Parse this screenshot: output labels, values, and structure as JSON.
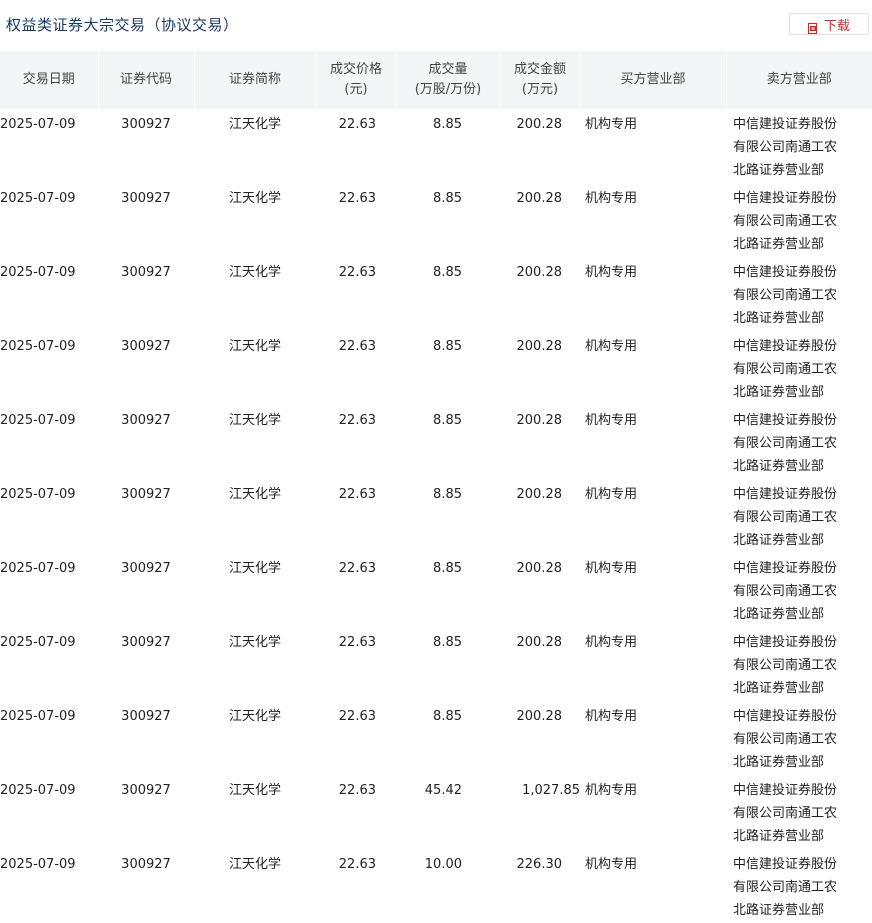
{
  "header": {
    "title": "权益类证券大宗交易（协议交易）",
    "download_label": "下载",
    "download_icon": "pdf-download-icon"
  },
  "table": {
    "columns": [
      {
        "line1": "交易日期",
        "line2": ""
      },
      {
        "line1": "证券代码",
        "line2": ""
      },
      {
        "line1": "证券简称",
        "line2": ""
      },
      {
        "line1": "成交价格",
        "line2": "(元)"
      },
      {
        "line1": "成交量",
        "line2": "(万股/万份)"
      },
      {
        "line1": "成交金额",
        "line2": "(万元)"
      },
      {
        "line1": "买方营业部",
        "line2": ""
      },
      {
        "line1": "卖方营业部",
        "line2": ""
      }
    ],
    "rows": [
      {
        "date": "2025-07-09",
        "code": "300927",
        "name": "江天化学",
        "price": "22.63",
        "volume": "8.85",
        "amount": "200.28",
        "buyer": "机构专用",
        "seller": "中信建投证券股份有限公司南通工农北路证券营业部"
      },
      {
        "date": "2025-07-09",
        "code": "300927",
        "name": "江天化学",
        "price": "22.63",
        "volume": "8.85",
        "amount": "200.28",
        "buyer": "机构专用",
        "seller": "中信建投证券股份有限公司南通工农北路证券营业部"
      },
      {
        "date": "2025-07-09",
        "code": "300927",
        "name": "江天化学",
        "price": "22.63",
        "volume": "8.85",
        "amount": "200.28",
        "buyer": "机构专用",
        "seller": "中信建投证券股份有限公司南通工农北路证券营业部"
      },
      {
        "date": "2025-07-09",
        "code": "300927",
        "name": "江天化学",
        "price": "22.63",
        "volume": "8.85",
        "amount": "200.28",
        "buyer": "机构专用",
        "seller": "中信建投证券股份有限公司南通工农北路证券营业部"
      },
      {
        "date": "2025-07-09",
        "code": "300927",
        "name": "江天化学",
        "price": "22.63",
        "volume": "8.85",
        "amount": "200.28",
        "buyer": "机构专用",
        "seller": "中信建投证券股份有限公司南通工农北路证券营业部"
      },
      {
        "date": "2025-07-09",
        "code": "300927",
        "name": "江天化学",
        "price": "22.63",
        "volume": "8.85",
        "amount": "200.28",
        "buyer": "机构专用",
        "seller": "中信建投证券股份有限公司南通工农北路证券营业部"
      },
      {
        "date": "2025-07-09",
        "code": "300927",
        "name": "江天化学",
        "price": "22.63",
        "volume": "8.85",
        "amount": "200.28",
        "buyer": "机构专用",
        "seller": "中信建投证券股份有限公司南通工农北路证券营业部"
      },
      {
        "date": "2025-07-09",
        "code": "300927",
        "name": "江天化学",
        "price": "22.63",
        "volume": "8.85",
        "amount": "200.28",
        "buyer": "机构专用",
        "seller": "中信建投证券股份有限公司南通工农北路证券营业部"
      },
      {
        "date": "2025-07-09",
        "code": "300927",
        "name": "江天化学",
        "price": "22.63",
        "volume": "8.85",
        "amount": "200.28",
        "buyer": "机构专用",
        "seller": "中信建投证券股份有限公司南通工农北路证券营业部"
      },
      {
        "date": "2025-07-09",
        "code": "300927",
        "name": "江天化学",
        "price": "22.63",
        "volume": "45.42",
        "amount": "1,027.85",
        "buyer": "机构专用",
        "seller": "中信建投证券股份有限公司南通工农北路证券营业部"
      },
      {
        "date": "2025-07-09",
        "code": "300927",
        "name": "江天化学",
        "price": "22.63",
        "volume": "10.00",
        "amount": "226.30",
        "buyer": "机构专用",
        "seller": "中信建投证券股份有限公司南通工农北路证券营业部"
      }
    ]
  },
  "colors": {
    "title": "#1a3a66",
    "header_bg": "#f4f5f7",
    "accent_red": "#d9252a"
  }
}
